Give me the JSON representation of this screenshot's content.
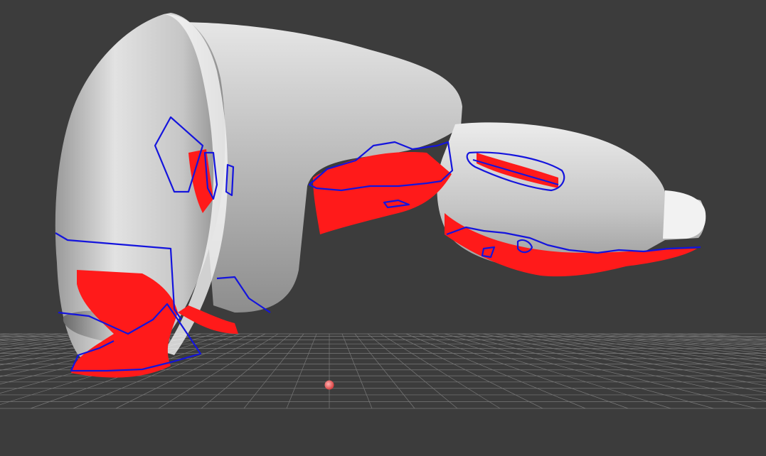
{
  "viewport": {
    "background_color": "#3c3c3c"
  },
  "model": {
    "surface_color": "#d8d8d8",
    "overhang_highlight_color": "#ff1a1a",
    "boundary_outline_color": "#1414dd"
  },
  "build_plate": {
    "grid_color": "#8c8c8c"
  },
  "marker": {
    "color": "#e85a5a"
  }
}
